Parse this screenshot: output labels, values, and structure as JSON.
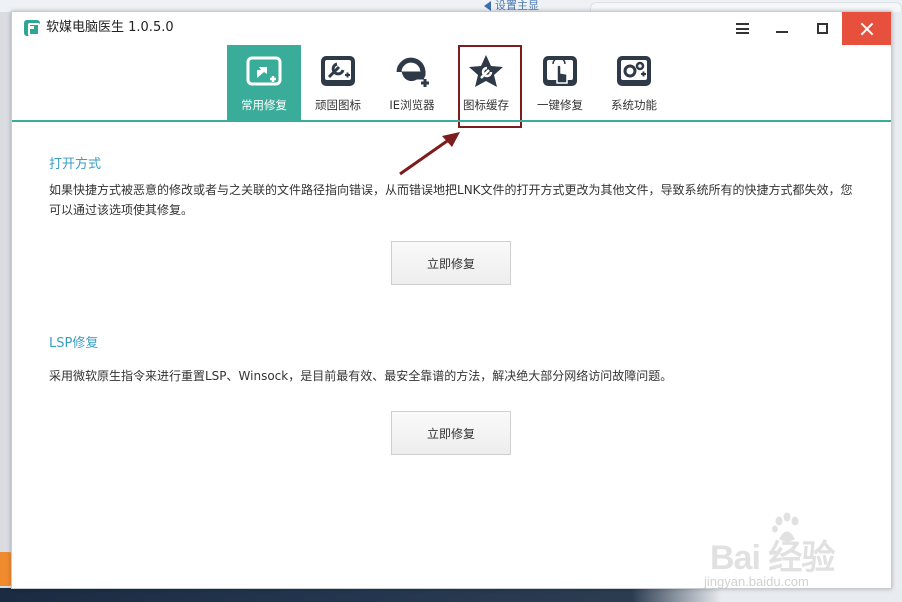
{
  "desktop": {
    "top_strip_text": "设置主显",
    "watermark_text": "Bai 经验",
    "watermark_url": "jingyan.baidu.com"
  },
  "window": {
    "title": "软媒电脑医生 1.0.5.0"
  },
  "toolbar": {
    "items": [
      {
        "label": "常用修复",
        "icon": "common-repair-icon",
        "active": true
      },
      {
        "label": "顽固图标",
        "icon": "stubborn-icon-icon",
        "active": false
      },
      {
        "label": "IE浏览器",
        "icon": "ie-browser-icon",
        "active": false
      },
      {
        "label": "图标缓存",
        "icon": "icon-cache-icon",
        "active": false,
        "highlighted": true
      },
      {
        "label": "一键修复",
        "icon": "one-click-repair-icon",
        "active": false
      },
      {
        "label": "系统功能",
        "icon": "system-function-icon",
        "active": false
      }
    ]
  },
  "sections": [
    {
      "title": "打开方式",
      "description": "如果快捷方式被恶意的修改或者与之关联的文件路径指向错误，从而错误地把LNK文件的打开方式更改为其他文件，导致系统所有的快捷方式都失效，您可以通过该选项使其修复。",
      "button_label": "立即修复"
    },
    {
      "title": "LSP修复",
      "description": "采用微软原生指令来进行重置LSP、Winsock，是目前最有效、最安全靠谱的方法，解决绝大部分网络访问故障问题。",
      "button_label": "立即修复"
    }
  ],
  "colors": {
    "accent": "#39ad99",
    "close_button": "#e7503c",
    "section_title": "#3a9ec2",
    "annotation": "#7d1c1c"
  }
}
